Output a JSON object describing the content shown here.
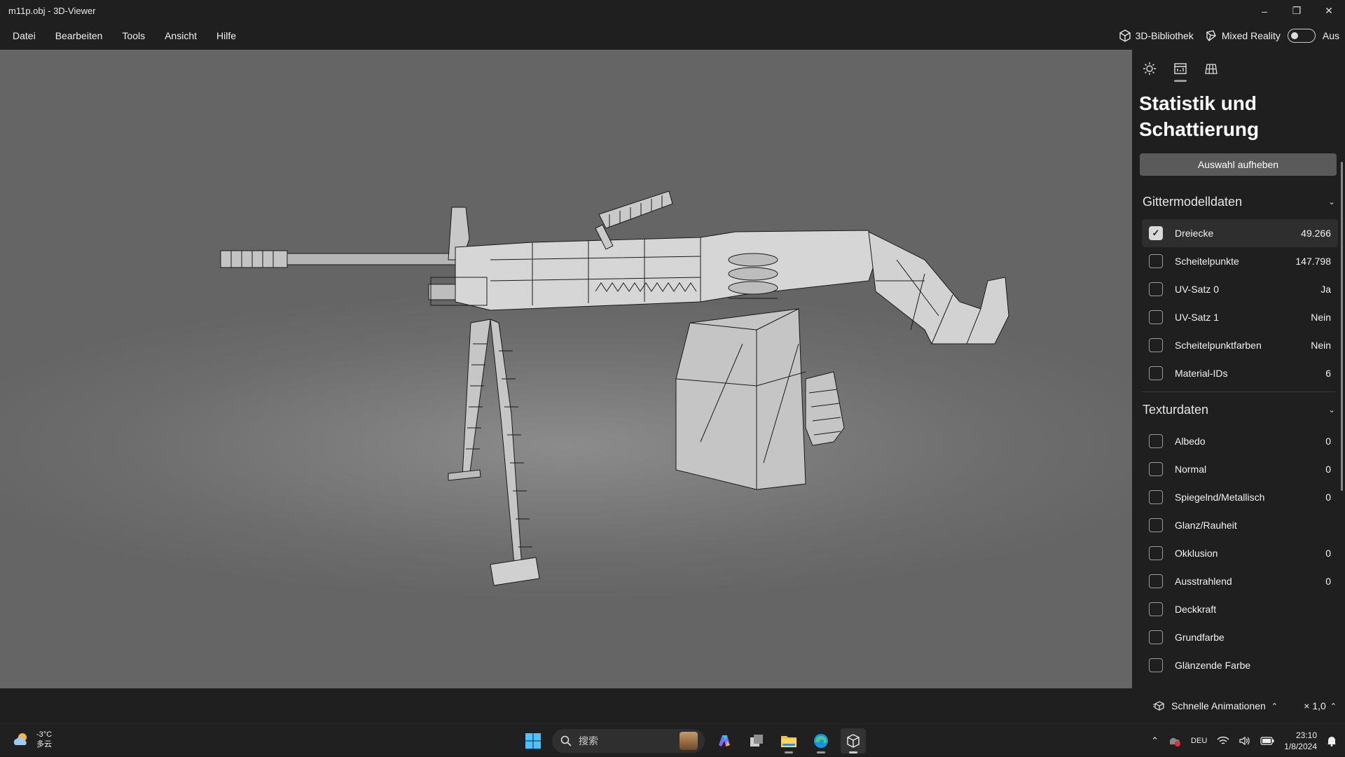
{
  "window": {
    "title": "m11p.obj - 3D-Viewer",
    "minimize": "–",
    "maximize": "❐",
    "close": "✕"
  },
  "menu": {
    "items": [
      "Datei",
      "Bearbeiten",
      "Tools",
      "Ansicht",
      "Hilfe"
    ],
    "library_label": "3D-Bibliothek",
    "mixed_reality_label": "Mixed Reality",
    "toggle_state": "Aus"
  },
  "panel": {
    "title": "Statistik und Schattierung",
    "deselect_label": "Auswahl aufheben",
    "mesh": {
      "heading": "Gittermodelldaten",
      "rows": [
        {
          "label": "Dreiecke",
          "value": "49.266",
          "checked": true
        },
        {
          "label": "Scheitelpunkte",
          "value": "147.798",
          "checked": false
        },
        {
          "label": "UV-Satz 0",
          "value": "Ja",
          "checked": false
        },
        {
          "label": "UV-Satz 1",
          "value": "Nein",
          "checked": false
        },
        {
          "label": "Scheitelpunktfarben",
          "value": "Nein",
          "checked": false
        },
        {
          "label": "Material-IDs",
          "value": "6",
          "checked": false
        }
      ]
    },
    "texture": {
      "heading": "Texturdaten",
      "rows": [
        {
          "label": "Albedo",
          "value": "0",
          "checked": false
        },
        {
          "label": "Normal",
          "value": "0",
          "checked": false
        },
        {
          "label": "Spiegelnd/Metallisch",
          "value": "0",
          "checked": false
        },
        {
          "label": "Glanz/Rauheit",
          "value": "",
          "checked": false
        },
        {
          "label": "Okklusion",
          "value": "0",
          "checked": false
        },
        {
          "label": "Ausstrahlend",
          "value": "0",
          "checked": false
        },
        {
          "label": "Deckkraft",
          "value": "",
          "checked": false
        },
        {
          "label": "Grundfarbe",
          "value": "",
          "checked": false
        },
        {
          "label": "Glänzende Farbe",
          "value": "",
          "checked": false
        }
      ]
    }
  },
  "status": {
    "animations_label": "Schnelle Animationen",
    "speed": "× 1,0"
  },
  "taskbar": {
    "temperature": "-3°C",
    "weather_text": "多云",
    "search_placeholder": "搜索",
    "language": "DEU",
    "time": "23:10",
    "date": "1/8/2024"
  }
}
